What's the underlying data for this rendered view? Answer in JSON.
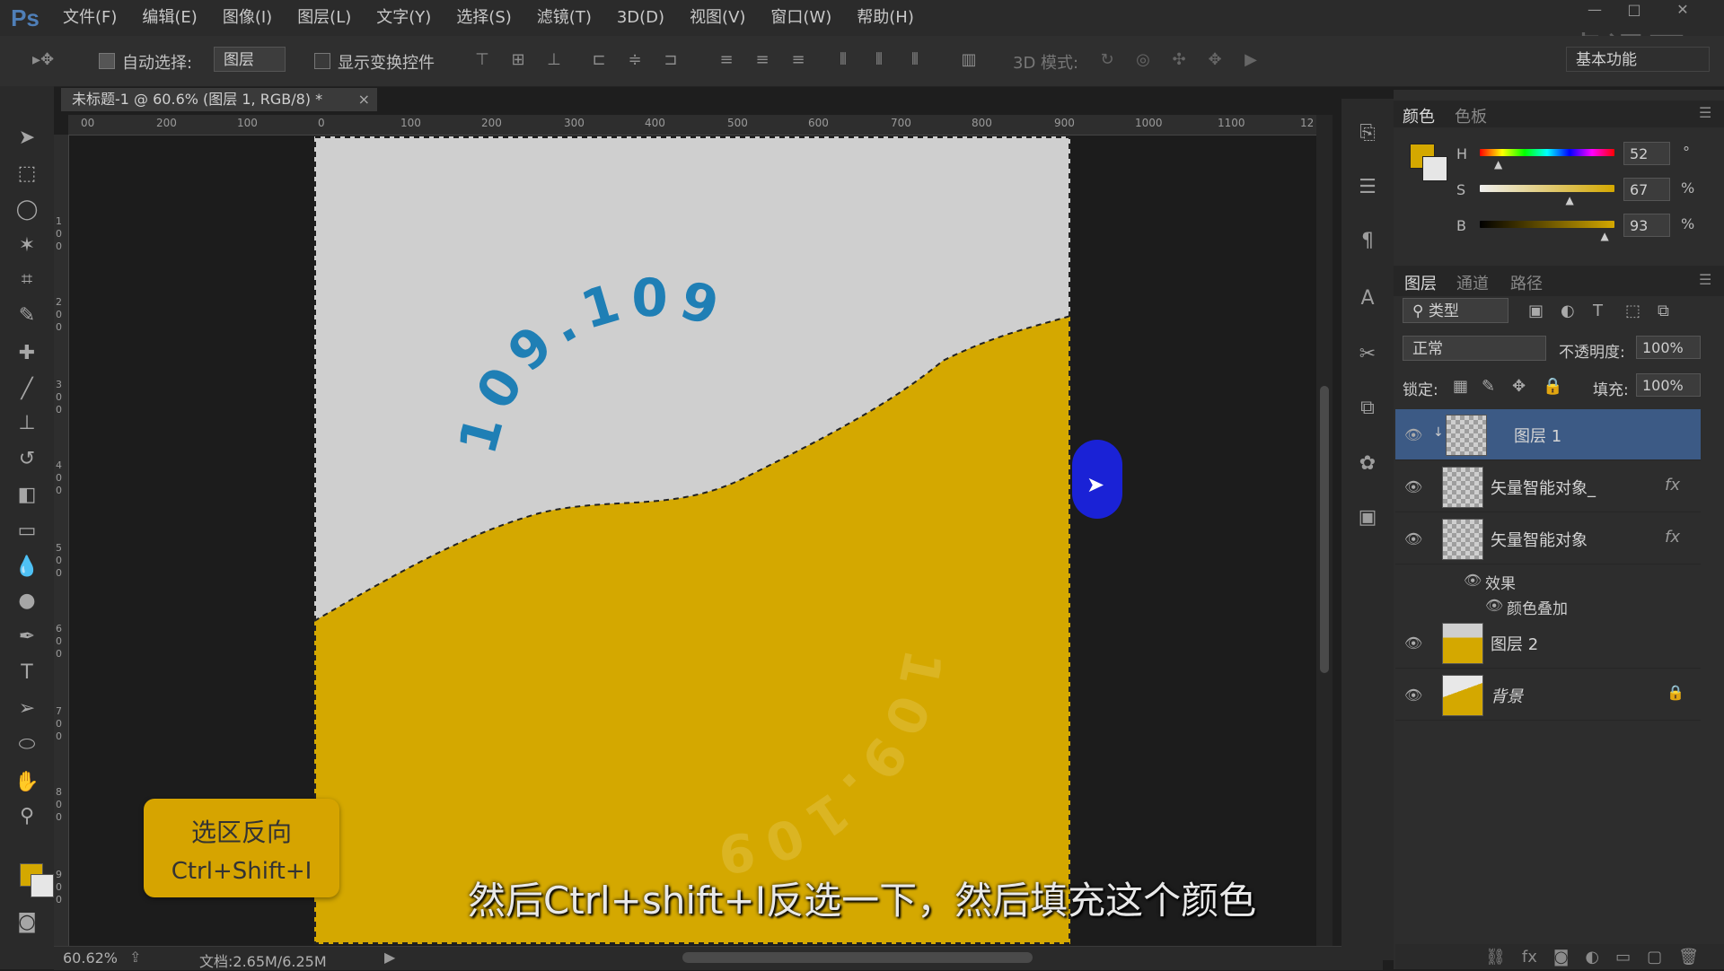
{
  "app": {
    "logo": "Ps",
    "menus": [
      "文件(F)",
      "编辑(E)",
      "图像(I)",
      "图层(L)",
      "文字(Y)",
      "选择(S)",
      "滤镜(T)",
      "3D(D)",
      "视图(V)",
      "窗口(W)",
      "帮助(H)"
    ],
    "window_controls": [
      "—",
      "□",
      "✕"
    ],
    "watermark": "虎课网"
  },
  "options_bar": {
    "auto_select_label": "自动选择:",
    "auto_select_value": "图层",
    "show_transform_label": "显示变换控件",
    "mode_3d_label": "3D 模式:",
    "workspace": "基本功能"
  },
  "document": {
    "tab_title": "未标题-1 @ 60.6% (图层 1, RGB/8) *",
    "ruler_ticks": [
      "00",
      "200",
      "100",
      "0",
      "100",
      "200",
      "300",
      "400",
      "500",
      "600",
      "700",
      "800",
      "900",
      "1000",
      "1100",
      "12"
    ],
    "vertical_ticks": [
      "1",
      "0",
      "0",
      "2",
      "0",
      "0",
      "3",
      "0",
      "0",
      "4",
      "0",
      "0",
      "5",
      "0",
      "0",
      "6",
      "0",
      "0",
      "7",
      "0",
      "0",
      "8",
      "0",
      "0",
      "9",
      "0",
      "0"
    ],
    "canvas_text_top": "109.109",
    "canvas_text_bottom": "109.109"
  },
  "status": {
    "zoom": "60.62%",
    "doc_size": "文档:2.65M/6.25M"
  },
  "color_panel": {
    "tabs": [
      "颜色",
      "色板"
    ],
    "swatch_color": "#d4a800",
    "h_label": "H",
    "h_value": "52",
    "h_unit": "°",
    "h_level": 0.14,
    "s_label": "S",
    "s_value": "67",
    "s_unit": "%",
    "s_level": 0.67,
    "b_label": "B",
    "b_value": "93",
    "b_unit": "%",
    "b_level": 0.93
  },
  "layers_panel": {
    "tabs": [
      "图层",
      "通道",
      "路径"
    ],
    "filter_label": "类型",
    "blend_mode": "正常",
    "opacity_label": "不透明度:",
    "opacity_value": "100%",
    "lock_label": "锁定:",
    "fill_label": "填充:",
    "fill_value": "100%",
    "layers": [
      {
        "name": "图层 1",
        "selected": true
      },
      {
        "name": "矢量智能对象_",
        "fx": "fx"
      },
      {
        "name": "矢量智能对象",
        "fx": "fx"
      },
      {
        "name": "图层 2"
      },
      {
        "name": "背景"
      }
    ],
    "effects_label": "效果",
    "effect_item": "颜色叠加"
  },
  "overlay": {
    "shortcut_title": "选区反向",
    "shortcut_keys": "Ctrl+Shift+I",
    "subtitle": "然后Ctrl+shift+I反选一下，然后填充这个颜色"
  },
  "colors": {
    "accent_yellow": "#d4a800",
    "text_blue": "#1f7fb5",
    "selected_layer": "#3c5a85"
  }
}
